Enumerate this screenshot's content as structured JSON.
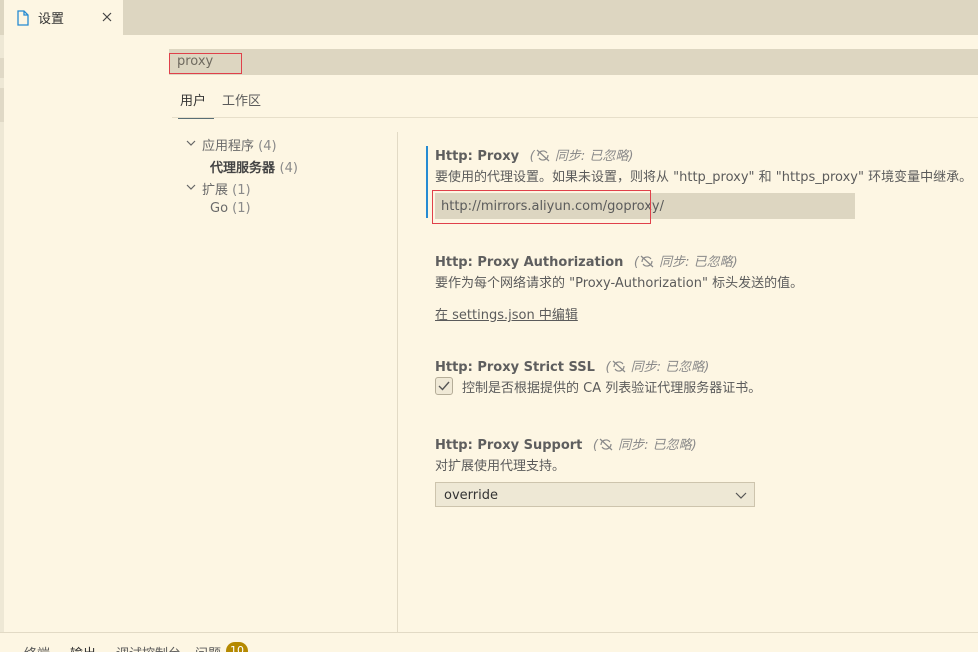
{
  "tab": {
    "label": "设置",
    "icon": "file-icon",
    "close_icon": "close-icon"
  },
  "search": {
    "value": "proxy"
  },
  "scope_tabs": [
    {
      "label": "用户",
      "active": true
    },
    {
      "label": "工作区",
      "active": false
    }
  ],
  "toc": [
    {
      "label": "应用程序",
      "count": "(4)",
      "expanded": true
    },
    {
      "label": "代理服务器",
      "count": "(4)",
      "selected": true
    },
    {
      "label": "扩展",
      "count": "(1)",
      "expanded": true
    },
    {
      "label": "Go",
      "count": "(1)"
    }
  ],
  "settings": [
    {
      "category": "Http: ",
      "name": "Proxy",
      "sync": "同步: 已忽略",
      "description": "要使用的代理设置。如果未设置，则将从 \"http_proxy\" 和 \"https_proxy\" 环境变量中继承。",
      "value": "http://mirrors.aliyun.com/goproxy/"
    },
    {
      "category": "Http: ",
      "name": "Proxy Authorization",
      "sync": "同步: 已忽略",
      "description": "要作为每个网络请求的 \"Proxy-Authorization\" 标头发送的值。",
      "link": "在 settings.json 中编辑"
    },
    {
      "category": "Http: ",
      "name": "Proxy Strict SSL",
      "sync": "同步: 已忽略",
      "description": "控制是否根据提供的 CA 列表验证代理服务器证书。",
      "checked": true
    },
    {
      "category": "Http: ",
      "name": "Proxy Support",
      "sync": "同步: 已忽略",
      "description": "对扩展使用代理支持。",
      "value": "override"
    }
  ],
  "panel": {
    "tabs": [
      {
        "label": "终端"
      },
      {
        "label": "输出",
        "active": true
      },
      {
        "label": "调试控制台"
      },
      {
        "label": "问题"
      }
    ],
    "problems_badge": "10"
  },
  "colors": {
    "background": "#fdf6e3",
    "accent": "#268bd2",
    "highlight_box": "#e0404a",
    "badge": "#b58900"
  }
}
